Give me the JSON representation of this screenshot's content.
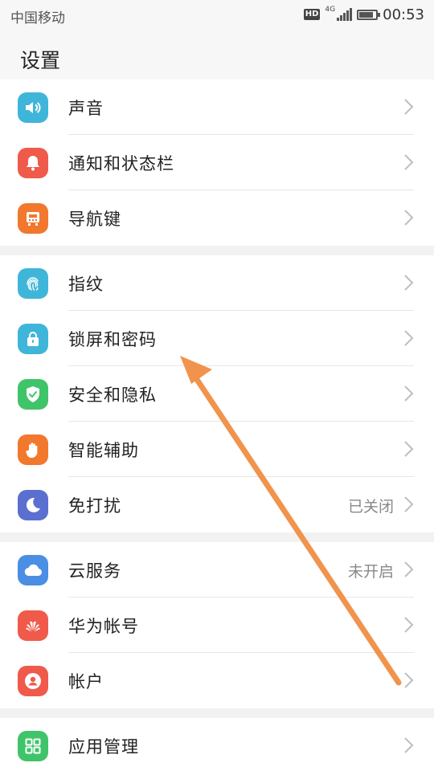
{
  "status_bar": {
    "carrier": "中国移动",
    "hd_badge": "HD",
    "network": "4G",
    "time": "00:53",
    "battery_level": 0.85
  },
  "header": {
    "title": "设置"
  },
  "groups": [
    {
      "items": [
        {
          "label": "声音",
          "icon": "speaker-icon",
          "color": "#3fb6d9"
        },
        {
          "label": "通知和状态栏",
          "icon": "bell-icon",
          "color": "#f05a4a"
        },
        {
          "label": "导航键",
          "icon": "navigation-key-icon",
          "color": "#f2782e"
        }
      ]
    },
    {
      "items": [
        {
          "label": "指纹",
          "icon": "fingerprint-icon",
          "color": "#3fb6d9"
        },
        {
          "label": "锁屏和密码",
          "icon": "lock-icon",
          "color": "#3fb6d9"
        },
        {
          "label": "安全和隐私",
          "icon": "shield-icon",
          "color": "#40c46a"
        },
        {
          "label": "智能辅助",
          "icon": "hand-icon",
          "color": "#f2782e"
        },
        {
          "label": "免打扰",
          "icon": "moon-icon",
          "color": "#5b6fd1",
          "value": "已关闭"
        }
      ]
    },
    {
      "items": [
        {
          "label": "云服务",
          "icon": "cloud-icon",
          "color": "#4a8fe3",
          "value": "未开启"
        },
        {
          "label": "华为帐号",
          "icon": "huawei-logo-icon",
          "color": "#f05a4a"
        },
        {
          "label": "帐户",
          "icon": "user-icon",
          "color": "#f05a4a"
        }
      ]
    },
    {
      "items": [
        {
          "label": "应用管理",
          "icon": "apps-grid-icon",
          "color": "#40c46a"
        }
      ]
    }
  ],
  "annotation": {
    "arrow_color": "#f0944d"
  }
}
